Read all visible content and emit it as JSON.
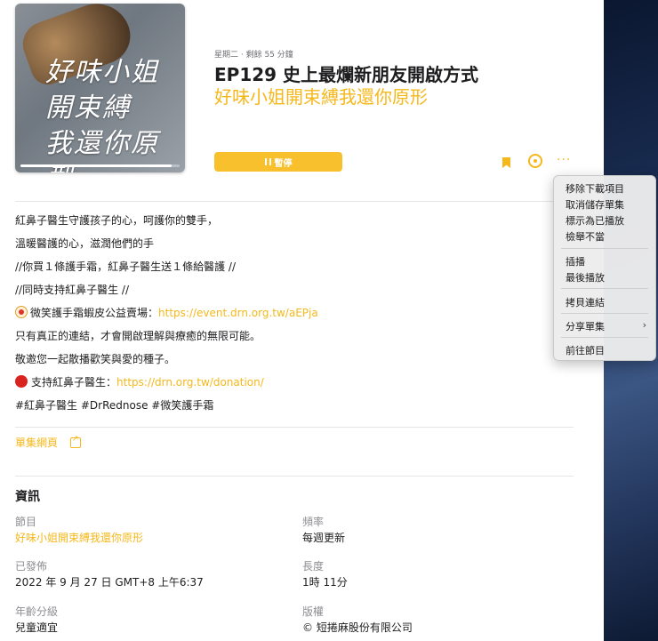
{
  "episode": {
    "meta": "星期二 · 剩餘 55 分鐘",
    "title": "EP129  史上最爛新朋友開啟方式",
    "show": "好味小姐開束縛我還你原形",
    "artwork_text": [
      "好味小姐",
      "開束縛",
      "我還你原型"
    ],
    "playback_progress": 0.95
  },
  "actions": {
    "pause_label": "暫停",
    "pause_icon": "pause-icon",
    "bookmark_icon": "bookmark-icon",
    "progress_icon": "progress-ring-icon",
    "more_icon": "ellipsis-icon",
    "more_label": "···"
  },
  "description": {
    "line1": "紅鼻子醫生守護孩子的心，呵護你的雙手，",
    "line2": "溫暖醫護的心，滋潤他們的手",
    "line3": "//你買１條護手霜，紅鼻子醫生送１條給醫護 //",
    "line4": "//同時支持紅鼻子醫生 //",
    "line5_text": "微笑護手霜蝦皮公益賣場：",
    "line5_link": "https://event.drn.org.tw/aEPja",
    "line6": "只有真正的連結，才會開啟理解與療癒的無限可能。",
    "line7": "敬邀您一起散播歡笑與愛的種子。",
    "line8_text": "支持紅鼻子醫生：",
    "line8_link": "https://drn.org.tw/donation/",
    "line9": "#紅鼻子醫生 #DrRednose #微笑護手霜"
  },
  "episode_page_label": "單集網頁",
  "info": {
    "heading": "資訊",
    "show_label": "節目",
    "show_value": "好味小姐開束縛我還你原形",
    "frequency_label": "頻率",
    "frequency_value": "每週更新",
    "published_label": "已發佈",
    "published_value": "2022 年 9 月 27 日 GMT+8 上午6:37",
    "length_label": "長度",
    "length_value": "1時 11分",
    "age_label": "年齡分級",
    "age_value": "兒童適宜",
    "copyright_label": "版權",
    "copyright_value": "© 短捲麻股份有限公司"
  },
  "context_menu": {
    "remove_download": "移除下載項目",
    "unsave": "取消儲存單集",
    "mark_played": "標示為已播放",
    "report": "檢舉不當",
    "play_next": "插播",
    "play_last": "最後播放",
    "copy_link": "拷貝連結",
    "share": "分享單集",
    "go_to_show": "前往節目",
    "submenu_arrow": "›"
  },
  "colors": {
    "accent": "#f5b81c",
    "text": "#1d1d1f",
    "secondary": "#8e8e93"
  }
}
